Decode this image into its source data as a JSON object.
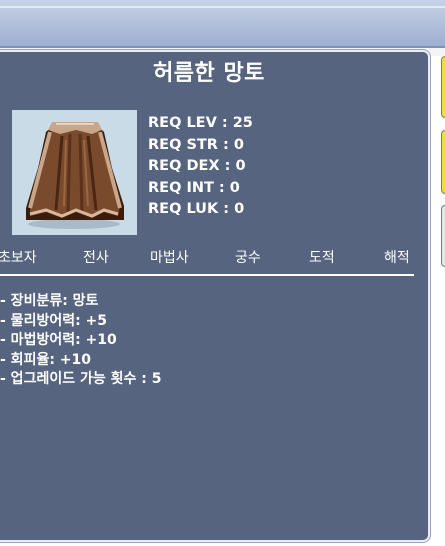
{
  "item": {
    "name": "허름한 망토",
    "icon": "brown-cape-icon",
    "requirements": [
      "REQ LEV : 25",
      "REQ STR : 0",
      "REQ DEX : 0",
      "REQ INT : 0",
      "REQ LUK : 0"
    ],
    "jobs": [
      "초보자",
      "전사",
      "마법사",
      "궁수",
      "도적",
      "해적"
    ],
    "stats": [
      "- 장비분류: 망토",
      "- 물리방어력: +5",
      "- 마법방어력: +10",
      "- 회피율: +10",
      "- 업그레이드 가능 횟수 : 5"
    ]
  },
  "colors": {
    "panel": "#56647f",
    "text": "#ffffff",
    "icon_bg": "#c9dbe6",
    "side_yellow": "#f2dc35",
    "side_gray": "#e6e6e6"
  }
}
